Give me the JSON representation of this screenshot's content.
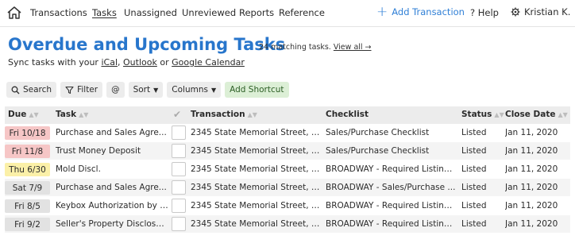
{
  "nav": {
    "links": [
      "Transactions",
      "Tasks",
      "Unassigned",
      "Unreviewed",
      "Reports",
      "Reference"
    ],
    "active_index": 1,
    "add_transaction": "Add Transaction",
    "help": "Help",
    "user": "Kristian K.",
    "icons": {
      "home": "home-icon",
      "help": "question-icon",
      "user": "gear-icon",
      "add": "plus-icon"
    }
  },
  "header": {
    "title": "Overdue and Upcoming Tasks",
    "match_count": "24 matching tasks.",
    "view_all": "View all →",
    "sync_prefix": "Sync tasks with your",
    "ical": "iCal",
    "comma": ",",
    "outlook": "Outlook",
    "or": "or",
    "google": "Google Calendar"
  },
  "toolbar": {
    "search": "Search",
    "filter": "Filter",
    "at": "@",
    "sort": "Sort",
    "columns": "Columns",
    "add_shortcut": "Add Shortcut"
  },
  "table": {
    "headers": {
      "due": "Due",
      "task": "Task",
      "transaction": "Transaction",
      "checklist": "Checklist",
      "status": "Status",
      "close_date": "Close Date"
    },
    "rows": [
      {
        "due": "Fri 10/18",
        "due_color": "#f6c6c6",
        "task": "Purchase and Sales Agre...",
        "transaction": "2345 State Memorial Street, S...",
        "checklist": "Sales/Purchase Checklist",
        "status": "Listed",
        "close_date": "Jan 11, 2020"
      },
      {
        "due": "Fri 11/8",
        "due_color": "#f6c6c6",
        "task": "Trust Money Deposit",
        "transaction": "2345 State Memorial Street, S...",
        "checklist": "Sales/Purchase Checklist",
        "status": "Listed",
        "close_date": "Jan 11, 2020"
      },
      {
        "due": "Thu 6/30",
        "due_color": "#fbf0a8",
        "task": "Mold Discl.",
        "transaction": "2345 State Memorial Street, S...",
        "checklist": "BROADWAY - Required Listing ...",
        "status": "Listed",
        "close_date": "Jan 11, 2020"
      },
      {
        "due": "Sat 7/9",
        "due_color": "#e2e2e2",
        "task": "Purchase and Sales Agre...",
        "transaction": "2345 State Memorial Street, S...",
        "checklist": "BROADWAY - Sales/Purchase ...",
        "status": "Listed",
        "close_date": "Jan 11, 2020"
      },
      {
        "due": "Fri 8/5",
        "due_color": "#e2e2e2",
        "task": "Keybox Authorization by T...",
        "transaction": "2345 State Memorial Street, S...",
        "checklist": "BROADWAY - Required Listing ...",
        "status": "Listed",
        "close_date": "Jan 11, 2020"
      },
      {
        "due": "Fri 9/2",
        "due_color": "#e2e2e2",
        "task": "Seller's Property Disclosur...",
        "transaction": "2345 State Memorial Street, S...",
        "checklist": "BROADWAY - Required Listing ...",
        "status": "Listed",
        "close_date": "Jan 11, 2020"
      }
    ]
  }
}
